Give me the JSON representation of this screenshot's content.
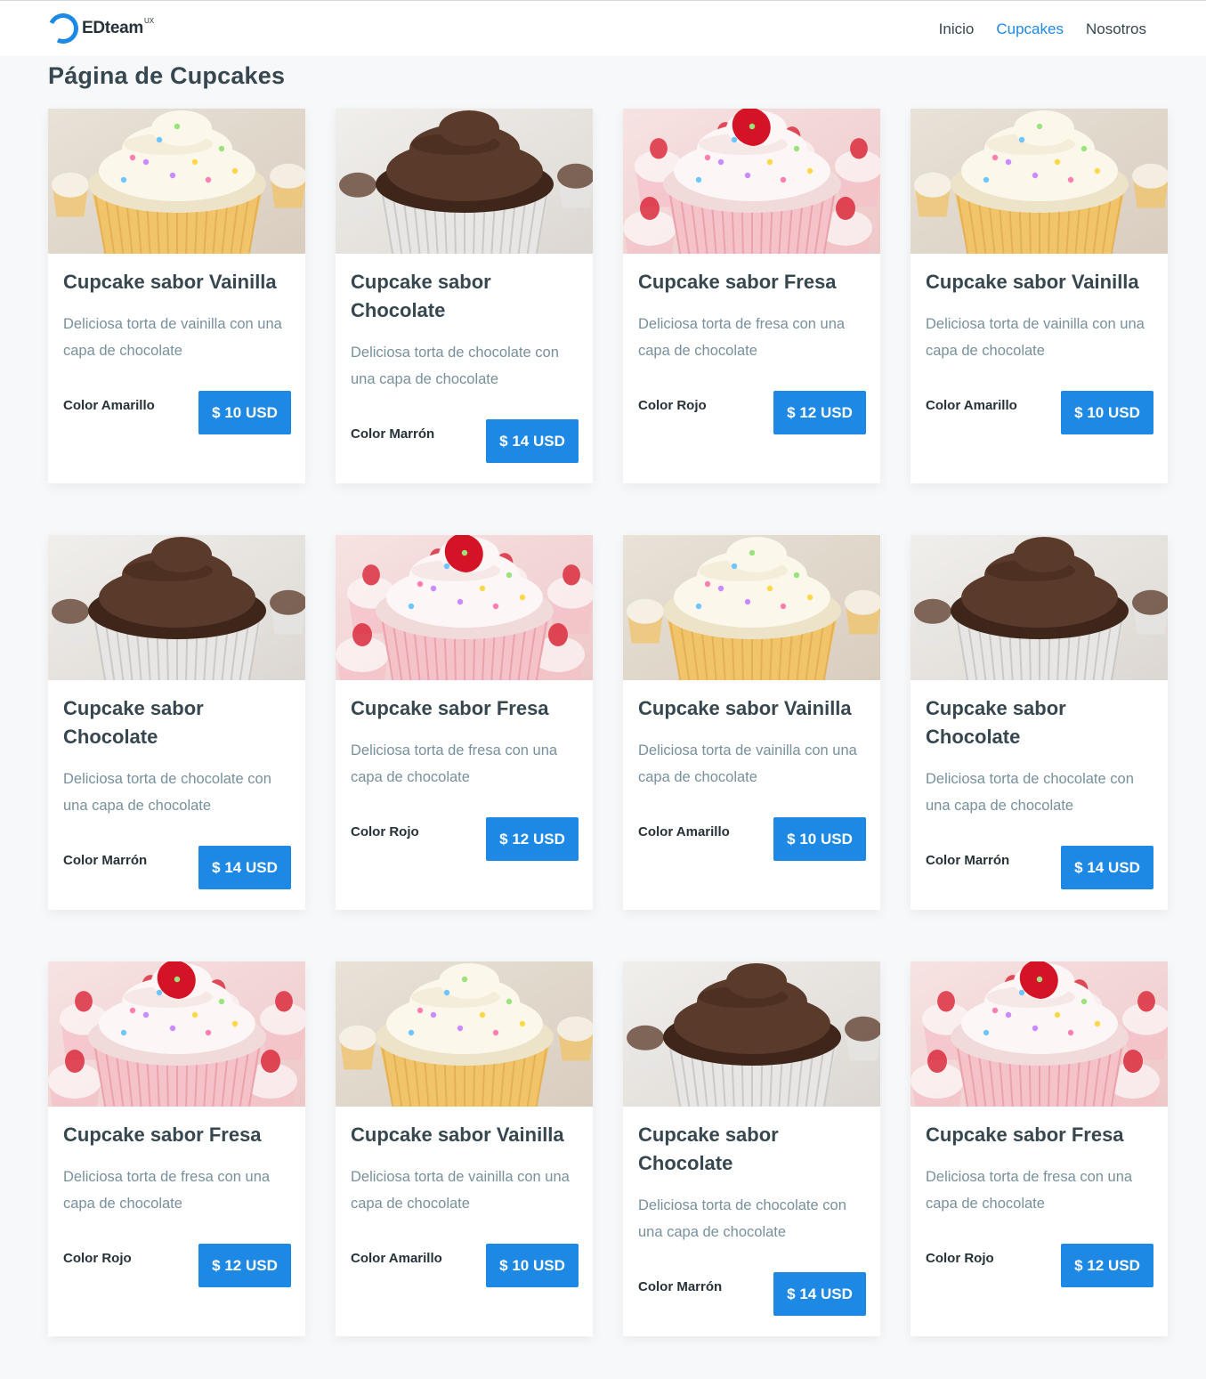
{
  "header": {
    "logo_text": "EDteam",
    "logo_sup": "UX",
    "nav": [
      {
        "label": "Inicio",
        "active": false
      },
      {
        "label": "Cupcakes",
        "active": true
      },
      {
        "label": "Nosotros",
        "active": false
      }
    ]
  },
  "page_title": "Página de Cupcakes",
  "colors": {
    "accent": "#1e88e5",
    "text": "#37474f",
    "muted": "#78909c"
  },
  "cards": [
    {
      "flavor": "vanilla",
      "title": "Cupcake sabor Vainilla",
      "description": "Deliciosa torta de vainilla con una capa de chocolate",
      "color": "Color Amarillo",
      "price": "$ 10 USD"
    },
    {
      "flavor": "chocolate",
      "title": "Cupcake sabor Chocolate",
      "description": "Deliciosa torta de chocolate con una capa de chocolate",
      "color": "Color Marrón",
      "price": "$ 14 USD"
    },
    {
      "flavor": "strawberry",
      "title": "Cupcake sabor Fresa",
      "description": "Deliciosa torta de fresa con una capa de chocolate",
      "color": "Color Rojo",
      "price": "$ 12 USD"
    },
    {
      "flavor": "vanilla",
      "title": "Cupcake sabor Vainilla",
      "description": "Deliciosa torta de vainilla con una capa de chocolate",
      "color": "Color Amarillo",
      "price": "$ 10 USD"
    },
    {
      "flavor": "chocolate",
      "title": "Cupcake sabor Chocolate",
      "description": "Deliciosa torta de chocolate con una capa de chocolate",
      "color": "Color Marrón",
      "price": "$ 14 USD"
    },
    {
      "flavor": "strawberry",
      "title": "Cupcake sabor Fresa",
      "description": "Deliciosa torta de fresa con una capa de chocolate",
      "color": "Color Rojo",
      "price": "$ 12 USD"
    },
    {
      "flavor": "vanilla",
      "title": "Cupcake sabor Vainilla",
      "description": "Deliciosa torta de vainilla con una capa de chocolate",
      "color": "Color Amarillo",
      "price": "$ 10 USD"
    },
    {
      "flavor": "chocolate",
      "title": "Cupcake sabor Chocolate",
      "description": "Deliciosa torta de chocolate con una capa de chocolate",
      "color": "Color Marrón",
      "price": "$ 14 USD"
    },
    {
      "flavor": "strawberry",
      "title": "Cupcake sabor Fresa",
      "description": "Deliciosa torta de fresa con una capa de chocolate",
      "color": "Color Rojo",
      "price": "$ 12 USD"
    },
    {
      "flavor": "vanilla",
      "title": "Cupcake sabor Vainilla",
      "description": "Deliciosa torta de vainilla con una capa de chocolate",
      "color": "Color Amarillo",
      "price": "$ 10 USD"
    },
    {
      "flavor": "chocolate",
      "title": "Cupcake sabor Chocolate",
      "description": "Deliciosa torta de chocolate con una capa de chocolate",
      "color": "Color Marrón",
      "price": "$ 14 USD"
    },
    {
      "flavor": "strawberry",
      "title": "Cupcake sabor Fresa",
      "description": "Deliciosa torta de fresa con una capa de chocolate",
      "color": "Color Rojo",
      "price": "$ 12 USD"
    }
  ]
}
